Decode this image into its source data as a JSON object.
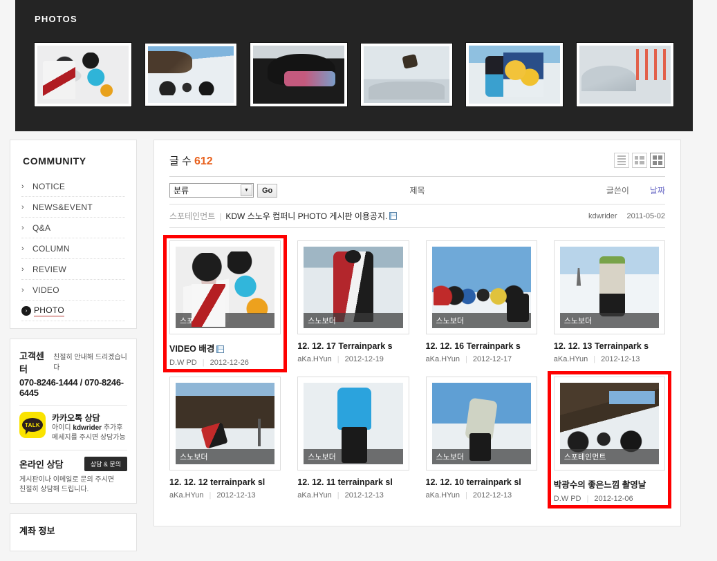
{
  "banner": {
    "title": "PHOTOS",
    "thumbs": [
      {
        "name": "banner-photo-kdw-rider",
        "art": "img-kdw"
      },
      {
        "name": "banner-photo-slope",
        "art": "img-slope"
      },
      {
        "name": "banner-photo-helmet",
        "art": "img-helmet"
      },
      {
        "name": "banner-photo-jump",
        "art": "img-jump"
      },
      {
        "name": "banner-photo-banana-costume",
        "art": "img-banana"
      },
      {
        "name": "banner-photo-terrain-park",
        "art": "img-park"
      }
    ]
  },
  "sidebar": {
    "community_title": "COMMUNITY",
    "nav_items": [
      {
        "label": "NOTICE",
        "selected": false
      },
      {
        "label": "NEWS&EVENT",
        "selected": false
      },
      {
        "label": "Q&A",
        "selected": false
      },
      {
        "label": "COLUMN",
        "selected": false
      },
      {
        "label": "REVIEW",
        "selected": false
      },
      {
        "label": "VIDEO",
        "selected": false
      },
      {
        "label": "PHOTO",
        "selected": true
      }
    ],
    "customer_center": {
      "title": "고객센터",
      "subtitle": "친절히 안내해 드리겠습니다",
      "phone": "070-8246-1444 / 070-8246-6445",
      "kakao_icon_label": "TALK",
      "kakao_title": "카카오톡 상담",
      "kakao_line1_pre": "아이디 ",
      "kakao_line1_id": "kdwrider",
      "kakao_line1_post": " 추가후",
      "kakao_line2": "메세지를 주시면 상담가능",
      "online_title": "온라인 상담",
      "online_button": "상담 & 문의",
      "online_desc_line1": "게시판이나 이메일로 문의 주시면",
      "online_desc_line2": "친절히 상담해 드립니다."
    },
    "account_info": {
      "title": "계좌 정보"
    }
  },
  "content": {
    "count_label": "글 수",
    "count_value": "612",
    "view_toggles": [
      {
        "name": "view-toggle-list",
        "active": false
      },
      {
        "name": "view-toggle-mixed",
        "active": false
      },
      {
        "name": "view-toggle-grid",
        "active": true
      }
    ],
    "filter": {
      "category_value": "분류",
      "go_label": "Go",
      "col_title": "제목",
      "col_author": "글쓴이",
      "col_date": "날짜"
    },
    "notice": {
      "category": "스포테인먼트",
      "title": "KDW 스노우 컴퍼니 PHOTO 게시판 이용공지.",
      "author": "kdwrider",
      "date": "2011-05-02"
    },
    "gallery": [
      {
        "title": "VIDEO 배경",
        "has_attachment": true,
        "tag": "스포테인먼트",
        "author": "D.W PD",
        "date": "2012-12-26",
        "art": "p1",
        "highlighted": true
      },
      {
        "title": "12. 12. 17 Terrainpark s",
        "has_attachment": false,
        "tag": "스노보더",
        "author": "aKa.HYun",
        "date": "2012-12-19",
        "art": "p2",
        "highlighted": false
      },
      {
        "title": "12. 12. 16 Terrainpark s",
        "has_attachment": false,
        "tag": "스노보더",
        "author": "aKa.HYun",
        "date": "2012-12-17",
        "art": "p3",
        "highlighted": false
      },
      {
        "title": "12. 12. 13 Terrainpark s",
        "has_attachment": false,
        "tag": "스노보더",
        "author": "aKa.HYun",
        "date": "2012-12-13",
        "art": "p4",
        "highlighted": false
      },
      {
        "title": "12. 12. 12 terrainpark sl",
        "has_attachment": false,
        "tag": "스노보더",
        "author": "aKa.HYun",
        "date": "2012-12-13",
        "art": "p5",
        "highlighted": false
      },
      {
        "title": "12. 12. 11 terrainpark sl",
        "has_attachment": false,
        "tag": "스노보더",
        "author": "aKa.HYun",
        "date": "2012-12-13",
        "art": "p6",
        "highlighted": false
      },
      {
        "title": "12. 12. 10 terrainpark sl",
        "has_attachment": false,
        "tag": "스노보더",
        "author": "aKa.HYun",
        "date": "2012-12-13",
        "art": "p7",
        "highlighted": false
      },
      {
        "title": "박광수의 좋은느낌 촬영날",
        "has_attachment": false,
        "tag": "스포테인먼트",
        "author": "D.W PD",
        "date": "2012-12-06",
        "art": "p8",
        "highlighted": true
      }
    ]
  },
  "colors": {
    "accent_orange": "#e8601c",
    "highlight_red": "#fe0000",
    "banner_dark": "#242424",
    "date_link": "#6f6fc8",
    "kakao_yellow": "#fae300"
  }
}
